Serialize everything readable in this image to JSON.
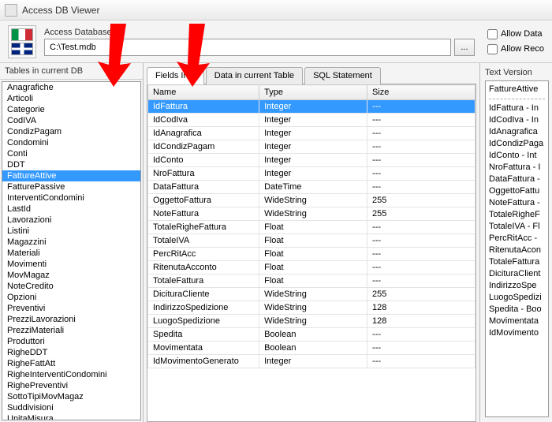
{
  "window": {
    "title": "Access DB Viewer"
  },
  "toolbar": {
    "db_label": "Access Database",
    "db_path": "C:\\Test.mdb",
    "browse_label": "...",
    "allow_data": "Allow Data",
    "allow_reco": "Allow Reco"
  },
  "sidebar": {
    "header": "Tables in current DB",
    "selected": "FattureAttive",
    "tables": [
      "Anagrafiche",
      "Articoli",
      "Categorie",
      "CodIVA",
      "CondizPagam",
      "Condomini",
      "Conti",
      "DDT",
      "FattureAttive",
      "FatturePassive",
      "InterventiCondomini",
      "LastId",
      "Lavorazioni",
      "Listini",
      "Magazzini",
      "Materiali",
      "Movimenti",
      "MovMagaz",
      "NoteCredito",
      "Opzioni",
      "Preventivi",
      "PrezziLavorazioni",
      "PrezziMateriali",
      "Produttori",
      "RigheDDT",
      "RigheFattAtt",
      "RigheInterventiCondomini",
      "RighePreventivi",
      "SottoTipiMovMagaz",
      "Suddivisioni",
      "UnitaMisura"
    ]
  },
  "tabs": {
    "items": [
      "Fields Info",
      "Data in current Table",
      "SQL Statement"
    ],
    "active": 0
  },
  "grid": {
    "headers": [
      "Name",
      "Type",
      "Size"
    ],
    "selected": 0,
    "rows": [
      [
        "IdFattura",
        "Integer",
        "---"
      ],
      [
        "IdCodIva",
        "Integer",
        "---"
      ],
      [
        "IdAnagrafica",
        "Integer",
        "---"
      ],
      [
        "IdCondizPagam",
        "Integer",
        "---"
      ],
      [
        "IdConto",
        "Integer",
        "---"
      ],
      [
        "NroFattura",
        "Integer",
        "---"
      ],
      [
        "DataFattura",
        "DateTime",
        "---"
      ],
      [
        "OggettoFattura",
        "WideString",
        "255"
      ],
      [
        "NoteFattura",
        "WideString",
        "255"
      ],
      [
        "TotaleRigheFattura",
        "Float",
        "---"
      ],
      [
        "TotaleIVA",
        "Float",
        "---"
      ],
      [
        "PercRitAcc",
        "Float",
        "---"
      ],
      [
        "RitenutaAcconto",
        "Float",
        "---"
      ],
      [
        "TotaleFattura",
        "Float",
        "---"
      ],
      [
        "DicituraCliente",
        "WideString",
        "255"
      ],
      [
        "IndirizzoSpedizione",
        "WideString",
        "128"
      ],
      [
        "LuogoSpedizione",
        "WideString",
        "128"
      ],
      [
        "Spedita",
        "Boolean",
        "---"
      ],
      [
        "Movimentata",
        "Boolean",
        "---"
      ],
      [
        "IdMovimentoGenerato",
        "Integer",
        "---"
      ]
    ]
  },
  "textversion": {
    "header": "Text Version",
    "table_name": "FattureAttive",
    "lines": [
      "IdFattura - In",
      "IdCodIva - In",
      "IdAnagrafica",
      "IdCondizPaga",
      "IdConto - Int",
      "NroFattura - I",
      "DataFattura -",
      "OggettoFattu",
      "NoteFattura -",
      "TotaleRigheF",
      "TotaleIVA - Fl",
      "PercRitAcc -",
      "RitenutaAcon",
      "TotaleFattura",
      "DicituraClient",
      "IndirizzoSpe",
      "LuogoSpedizi",
      "Spedita - Boo",
      "Movimentata",
      "IdMovimento"
    ]
  }
}
